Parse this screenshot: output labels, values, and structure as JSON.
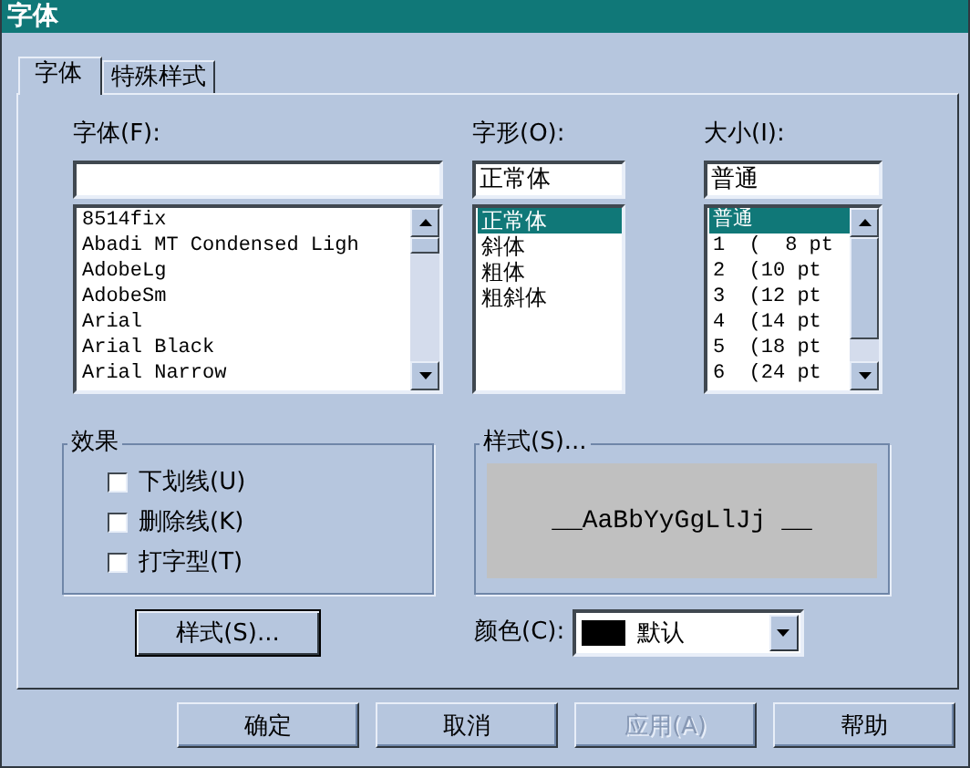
{
  "window": {
    "title": "字体"
  },
  "tabs": [
    {
      "label": "字体",
      "selected": true
    },
    {
      "label": "特殊样式",
      "selected": false
    }
  ],
  "font": {
    "label": "字体(F):",
    "items": [
      {
        "label": "8514fix",
        "selected": false
      },
      {
        "label": "Abadi MT Condensed Ligh",
        "selected": false
      },
      {
        "label": "AdobeLg",
        "selected": false
      },
      {
        "label": "AdobeSm",
        "selected": false
      },
      {
        "label": "Arial",
        "selected": false
      },
      {
        "label": "Arial Black",
        "selected": false
      },
      {
        "label": "Arial Narrow",
        "selected": false
      }
    ]
  },
  "style": {
    "label": "字形(O):",
    "value": "正常体",
    "items": [
      {
        "label": "正常体",
        "selected": true
      },
      {
        "label": "斜体",
        "selected": false
      },
      {
        "label": "粗体",
        "selected": false
      },
      {
        "label": "粗斜体",
        "selected": false
      }
    ]
  },
  "size": {
    "label": "大小(I):",
    "value": "普通",
    "items": [
      {
        "label": "普通",
        "selected": true
      },
      {
        "label": "1  (  8 pt",
        "selected": false
      },
      {
        "label": "2  (10 pt",
        "selected": false
      },
      {
        "label": "3  (12 pt",
        "selected": false
      },
      {
        "label": "4  (14 pt",
        "selected": false
      },
      {
        "label": "5  (18 pt",
        "selected": false
      },
      {
        "label": "6  (24 pt",
        "selected": false
      }
    ]
  },
  "effects": {
    "title": "效果",
    "options": [
      {
        "label": "下划线(U)",
        "checked": false
      },
      {
        "label": "删除线(K)",
        "checked": false
      },
      {
        "label": "打字型(T)",
        "checked": false
      }
    ]
  },
  "preview": {
    "title": "样式(S)...",
    "sample": "__AaBbYyGgLlJj __"
  },
  "style_button": {
    "label": "样式(S)..."
  },
  "color": {
    "label": "颜色(C):",
    "value": "默认",
    "color": "#000000"
  },
  "buttons": [
    {
      "label": "确定",
      "disabled": false
    },
    {
      "label": "取消",
      "disabled": false
    },
    {
      "label": "应用(A)",
      "disabled": true
    },
    {
      "label": "帮助",
      "disabled": false
    }
  ]
}
